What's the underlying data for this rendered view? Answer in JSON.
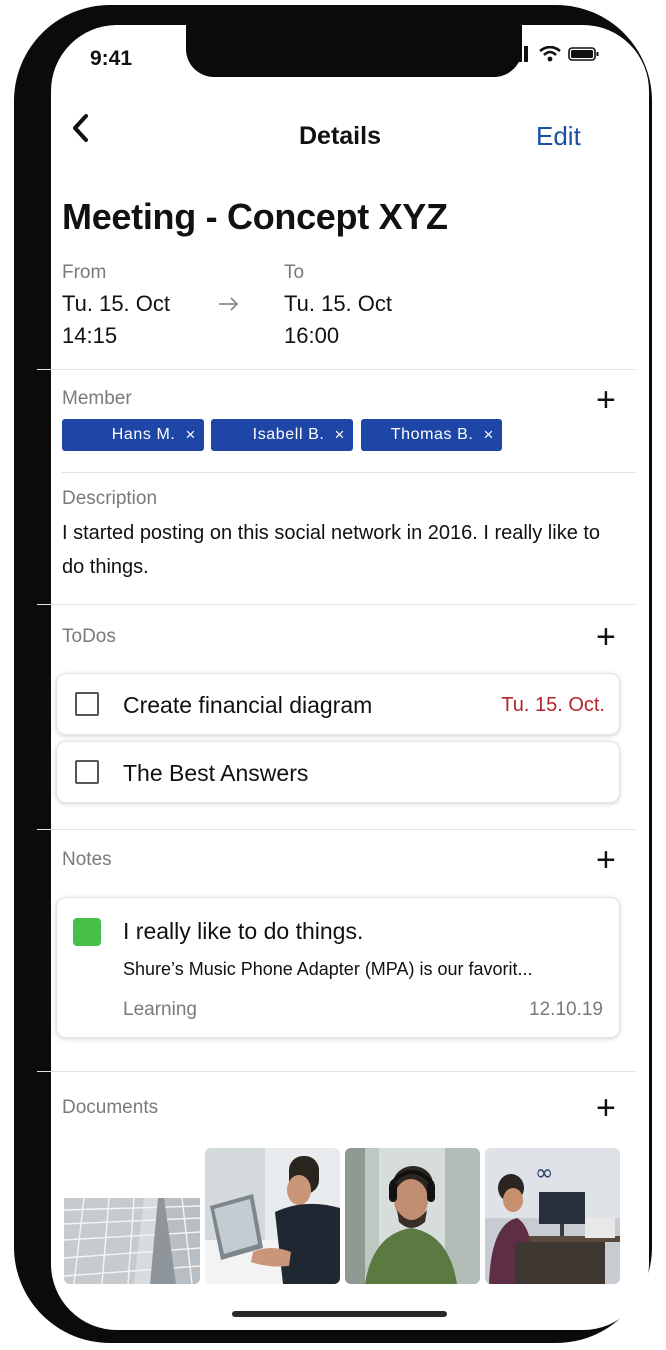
{
  "status_bar": {
    "time": "9:41"
  },
  "nav": {
    "back_icon": "chevron-left-icon",
    "title": "Details",
    "edit_label": "Edit"
  },
  "event": {
    "title": "Meeting - Concept XYZ",
    "from_label": "From",
    "from_date": "Tu. 15. Oct",
    "from_time": "14:15",
    "to_label": "To",
    "to_date": "Tu. 15. Oct",
    "to_time": "16:00"
  },
  "members": {
    "label": "Member",
    "chips": [
      {
        "name": "Hans M."
      },
      {
        "name": "Isabell B."
      },
      {
        "name": "Thomas B."
      }
    ],
    "remove_glyph": "×"
  },
  "description": {
    "label": "Description",
    "text": "I started posting on this social network in 2016. I really like to do things."
  },
  "todos": {
    "label": "ToDos",
    "items": [
      {
        "text": "Create financial diagram",
        "date": "Tu. 15. Oct.",
        "checked": false
      },
      {
        "text": "The Best Answers",
        "date": "",
        "checked": false
      }
    ]
  },
  "notes": {
    "label": "Notes",
    "items": [
      {
        "title": "I really like to do things.",
        "body": "Shure’s Music Phone Adapter (MPA) is our favorit...",
        "category": "Learning",
        "date": "12.10.19",
        "color": "#46c048"
      }
    ]
  },
  "documents": {
    "label": "Documents",
    "thumbnails": [
      "architecture-photo",
      "man-with-laptop-photo",
      "man-with-headphones-photo",
      "office-desk-photo"
    ]
  },
  "colors": {
    "accent": "#1d4ea3",
    "chip_bg": "#1e46a6",
    "date_red": "#b3262a",
    "note_green": "#46c048"
  },
  "plus_glyph": "+"
}
